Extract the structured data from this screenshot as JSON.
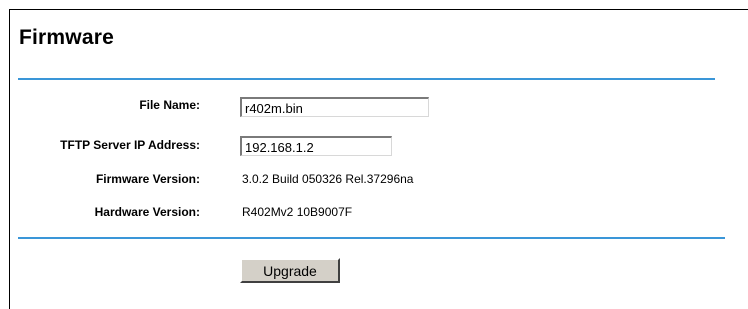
{
  "page": {
    "title": "Firmware",
    "accent_color": "#3a96d8"
  },
  "form": {
    "file_name_label": "File Name:",
    "file_name_value": "r402m.bin",
    "tftp_label": "TFTP Server IP Address:",
    "tftp_value": "192.168.1.2",
    "firmware_version_label": "Firmware Version:",
    "firmware_version_value": "3.0.2 Build 050326 Rel.37296na",
    "hardware_version_label": "Hardware Version:",
    "hardware_version_value": "R402Mv2 10B9007F"
  },
  "actions": {
    "upgrade_label": "Upgrade"
  }
}
